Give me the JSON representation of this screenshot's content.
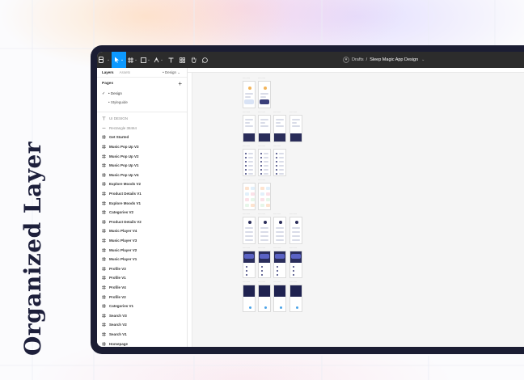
{
  "side_title": "Organized Layer",
  "toolbar": {
    "file_location": "Drafts",
    "separator": "/",
    "file_name": "Sleep Magic App Design",
    "icons": [
      "figma-menu-icon",
      "move-tool-icon",
      "frame-tool-icon",
      "shape-tool-icon",
      "pen-tool-icon",
      "text-tool-icon",
      "components-icon",
      "hand-tool-icon",
      "comment-icon"
    ]
  },
  "sidebar": {
    "tabs": {
      "layers": "Layers",
      "assets": "Assets",
      "design_selector": "• Design ⌄"
    },
    "pages_heading": "Pages",
    "add_page": "+",
    "pages": [
      {
        "label": "• Design",
        "checked": true
      },
      {
        "label": "• Styleguide",
        "checked": false
      }
    ],
    "layers": [
      {
        "label": "UI DESIGN",
        "icon": "text",
        "muted": true
      },
      {
        "label": "Rectangle 38464",
        "icon": "rect",
        "muted": true
      },
      {
        "label": "Get Started",
        "icon": "frame"
      },
      {
        "label": "Music Pop Up V3",
        "icon": "frame"
      },
      {
        "label": "Music Pop Up V2",
        "icon": "frame"
      },
      {
        "label": "Music Pop Up V1",
        "icon": "frame"
      },
      {
        "label": "Music Pop Up V4",
        "icon": "frame"
      },
      {
        "label": "Explore Moods V2",
        "icon": "frame"
      },
      {
        "label": "Product Details V1",
        "icon": "frame"
      },
      {
        "label": "Explore Moods V1",
        "icon": "frame"
      },
      {
        "label": "Categories V2",
        "icon": "frame"
      },
      {
        "label": "Product Details V2",
        "icon": "frame"
      },
      {
        "label": "Music Player V4",
        "icon": "frame"
      },
      {
        "label": "Music Player V3",
        "icon": "frame"
      },
      {
        "label": "Music Player V2",
        "icon": "frame"
      },
      {
        "label": "Music Player V1",
        "icon": "frame"
      },
      {
        "label": "Profile V3",
        "icon": "frame"
      },
      {
        "label": "Profile V1",
        "icon": "frame"
      },
      {
        "label": "Profile V4",
        "icon": "frame"
      },
      {
        "label": "Profile V2",
        "icon": "frame"
      },
      {
        "label": "Categories V1",
        "icon": "frame"
      },
      {
        "label": "Search V3",
        "icon": "frame"
      },
      {
        "label": "Search V2",
        "icon": "frame"
      },
      {
        "label": "Search V1",
        "icon": "frame"
      },
      {
        "label": "Homepage",
        "icon": "frame"
      }
    ]
  },
  "colors": {
    "toolbar_bg": "#2c2c2c",
    "accent": "#0d99ff",
    "device_frame": "#1b1d33",
    "app_dark": "#2a2d5a",
    "title_text": "#1d1f3b"
  }
}
